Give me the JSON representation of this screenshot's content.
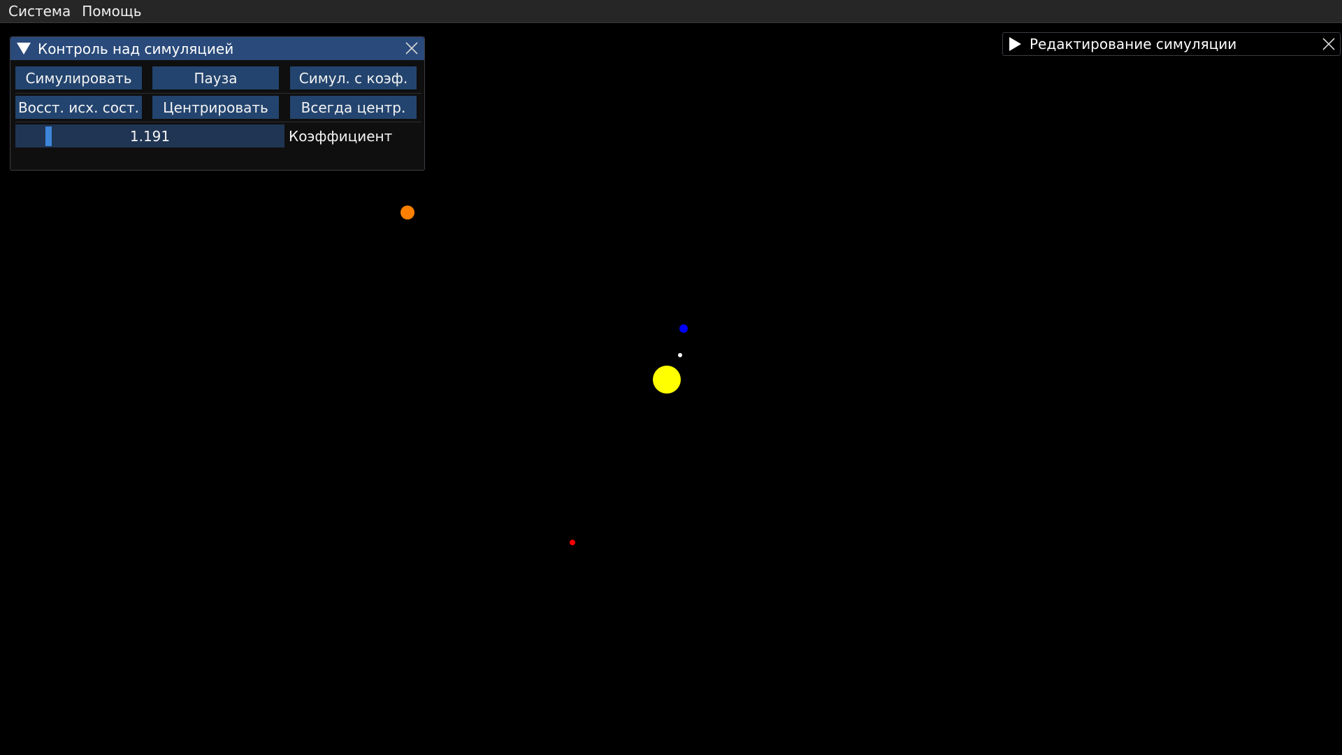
{
  "menubar": {
    "items": [
      "Система",
      "Помощь"
    ]
  },
  "control_panel": {
    "title": "Контроль над симуляцией",
    "buttons": {
      "simulate": "Симулировать",
      "pause": "Пауза",
      "simulate_coef": "Симул. с коэф.",
      "reset": "Восст. исх. сост.",
      "center": "Центрировать",
      "always_center": "Всегда центр."
    },
    "slider": {
      "value": "1.191",
      "label": "Коэффициент"
    }
  },
  "edit_panel": {
    "title": "Редактирование симуляции",
    "collapsed": true
  },
  "scene": {
    "background": "#000000",
    "bodies": [
      {
        "name": "sun",
        "color": "#ffff00"
      },
      {
        "name": "planet-blue",
        "color": "#0000ff"
      },
      {
        "name": "planet-white",
        "color": "#ffffff"
      },
      {
        "name": "planet-orange",
        "color": "#ff8000"
      },
      {
        "name": "planet-red",
        "color": "#ff0000"
      }
    ]
  },
  "colors": {
    "titlebar": "#294a7a",
    "button": "#23446e",
    "slider_bg": "#203553",
    "slider_grab": "#3d86d9"
  }
}
